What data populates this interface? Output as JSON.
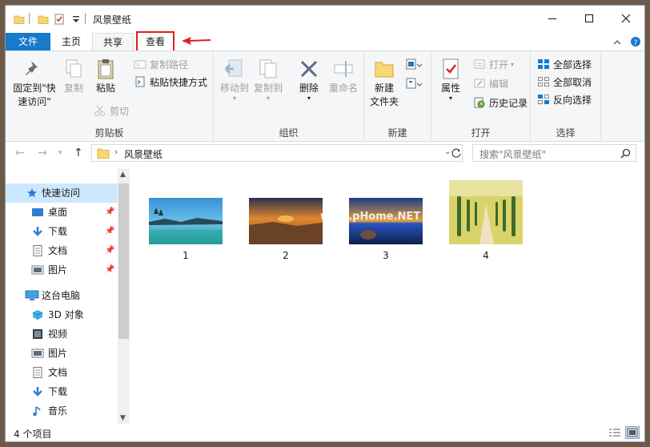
{
  "window": {
    "title": "风景壁纸"
  },
  "tabs": {
    "file": "文件",
    "home": "主页",
    "share": "共享",
    "view": "查看"
  },
  "ribbon": {
    "clipboard": {
      "pin_line1": "固定到\"快",
      "pin_line2": "速访问\"",
      "copy": "复制",
      "paste": "粘贴",
      "copy_path": "复制路径",
      "paste_shortcut": "粘贴快捷方式",
      "cut": "剪切",
      "label": "剪贴板"
    },
    "organize": {
      "move_to": "移动到",
      "copy_to": "复制到",
      "delete": "删除",
      "rename": "重命名",
      "label": "组织"
    },
    "new": {
      "new_folder_line1": "新建",
      "new_folder_line2": "文件夹",
      "label": "新建"
    },
    "open": {
      "properties": "属性",
      "open": "打开",
      "edit": "编辑",
      "history": "历史记录",
      "label": "打开"
    },
    "select": {
      "select_all": "全部选择",
      "select_none": "全部取消",
      "invert": "反向选择",
      "label": "选择"
    }
  },
  "address": {
    "path": "风景壁纸",
    "search_placeholder": "搜索\"风景壁纸\""
  },
  "sidebar": {
    "items": [
      {
        "label": "快速访问",
        "icon": "star-icon",
        "pinned": false
      },
      {
        "label": "桌面",
        "icon": "desktop-icon",
        "pinned": true
      },
      {
        "label": "下载",
        "icon": "download-icon",
        "pinned": true
      },
      {
        "label": "文档",
        "icon": "document-icon",
        "pinned": true
      },
      {
        "label": "图片",
        "icon": "pictures-icon",
        "pinned": true
      },
      {
        "label": "这台电脑",
        "icon": "computer-icon",
        "pinned": false
      },
      {
        "label": "3D 对象",
        "icon": "cube-icon",
        "pinned": false
      },
      {
        "label": "视频",
        "icon": "video-icon",
        "pinned": false
      },
      {
        "label": "图片",
        "icon": "pictures-icon",
        "pinned": false
      },
      {
        "label": "文档",
        "icon": "document-icon",
        "pinned": false
      },
      {
        "label": "下载",
        "icon": "download-icon",
        "pinned": false
      },
      {
        "label": "音乐",
        "icon": "music-icon",
        "pinned": false
      }
    ]
  },
  "files": [
    {
      "name": "1"
    },
    {
      "name": "2"
    },
    {
      "name": "3"
    },
    {
      "name": "4"
    }
  ],
  "watermark": "www.pHome.NET",
  "status": {
    "count": "4 个项目"
  },
  "colors": {
    "accent": "#1979ca",
    "highlight_border": "#e0201f",
    "selected_nav": "#cce8ff"
  }
}
